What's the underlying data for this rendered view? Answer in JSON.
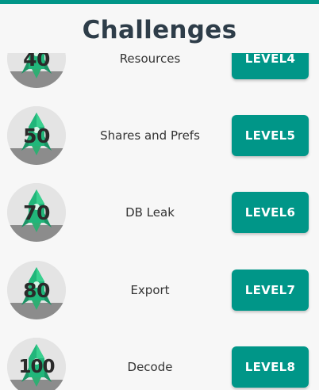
{
  "header": {
    "title": "Challenges"
  },
  "colors": {
    "accent": "#009688",
    "title": "#2e3d49"
  },
  "challenges": [
    {
      "points": "40",
      "name": "Resources",
      "level_label": "LEVEL4"
    },
    {
      "points": "50",
      "name": "Shares and Prefs",
      "level_label": "LEVEL5"
    },
    {
      "points": "70",
      "name": "DB Leak",
      "level_label": "LEVEL6"
    },
    {
      "points": "80",
      "name": "Export",
      "level_label": "LEVEL7"
    },
    {
      "points": "100",
      "name": "Decode",
      "level_label": "LEVEL8"
    }
  ],
  "icons": {
    "badge": "rocket-icon"
  }
}
